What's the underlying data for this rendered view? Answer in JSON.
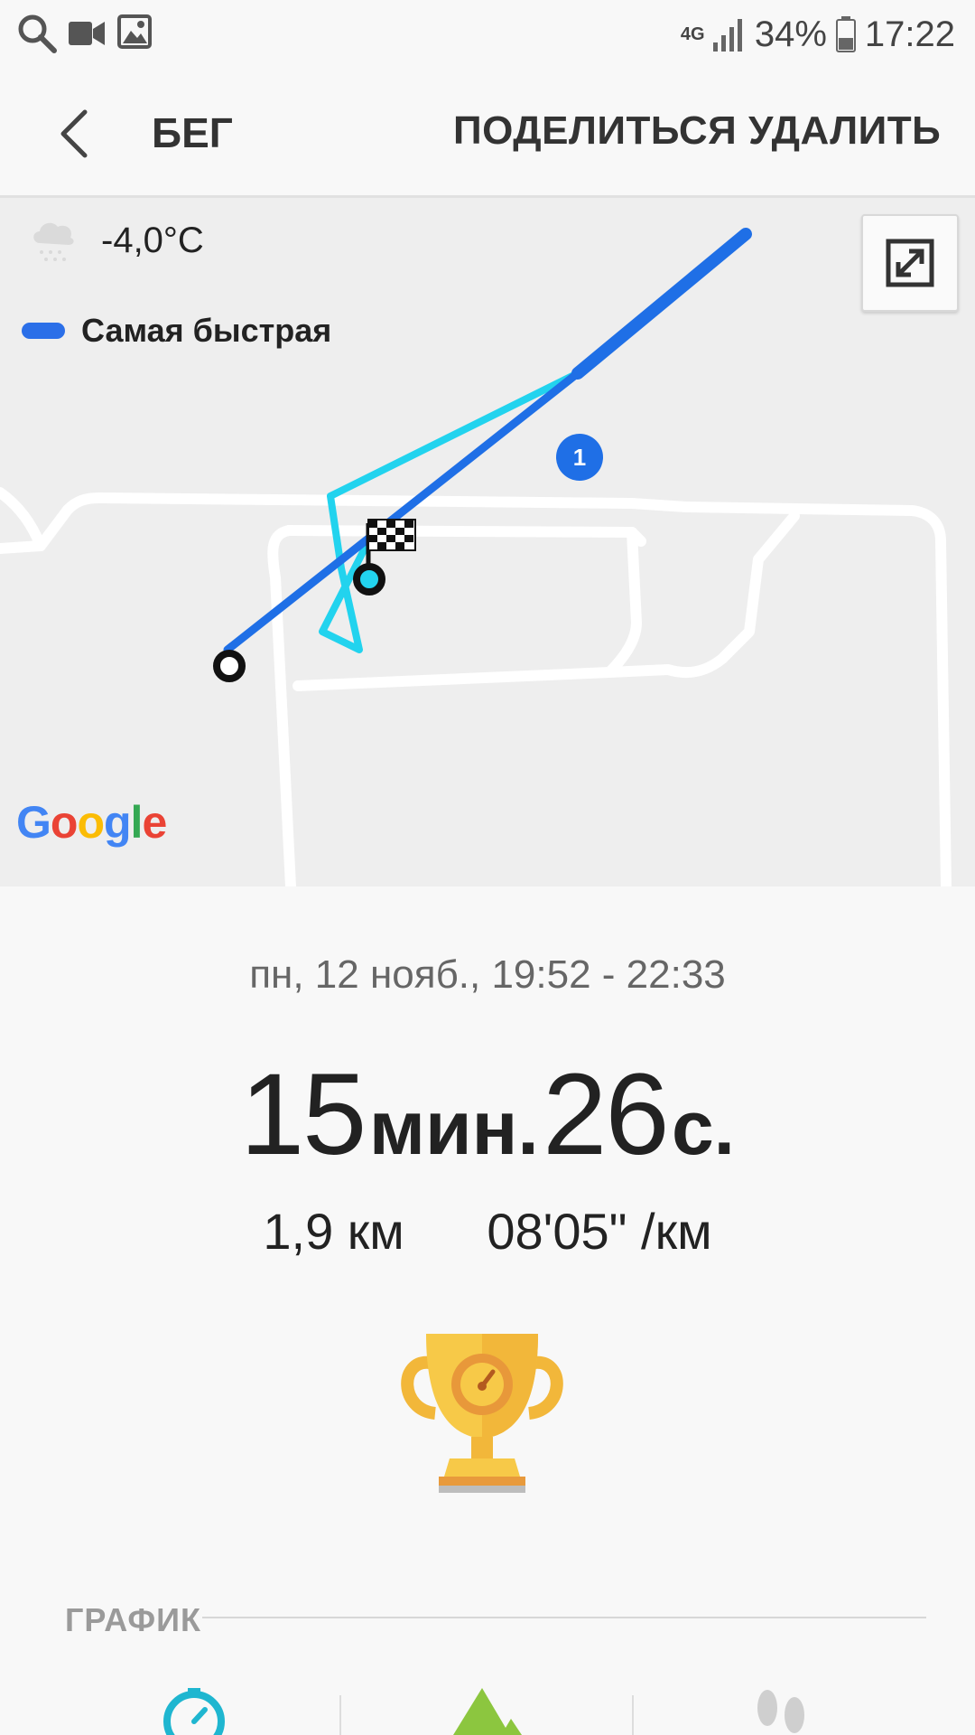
{
  "status_bar": {
    "network": "4G",
    "battery": "34%",
    "time": "17:22",
    "left_icons": [
      "search-icon",
      "video-icon",
      "image-icon"
    ]
  },
  "app_bar": {
    "title": "БЕГ",
    "share_label": "ПОДЕЛИТЬСЯ",
    "delete_label": "УДАЛИТЬ"
  },
  "map": {
    "temperature": "-4,0°C",
    "weather_icon": "cloud-snow-icon",
    "legend_label": "Самая быстрая",
    "legend_color": "#2b6fe8",
    "route_color_fast": "#1f6fe6",
    "route_color_track": "#22d3ee",
    "marker_label": "1",
    "provider": "Google"
  },
  "workout": {
    "date": "пн, 12 нояб., 19:52 - 22:33",
    "minutes": "15",
    "minutes_unit": "мин.",
    "seconds": "26",
    "seconds_unit": "с.",
    "distance": "1,9 км",
    "pace": "08'05\" /км"
  },
  "graph": {
    "section_title": "ГРАФИК"
  }
}
